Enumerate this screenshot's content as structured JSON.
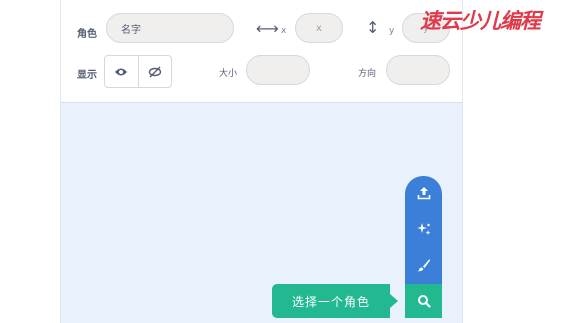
{
  "watermark": {
    "text": "速云少儿编程"
  },
  "sprite_info": {
    "sprite_label": "角色",
    "sprite_name_value": "名字",
    "x_label": "x",
    "x_value": "x",
    "y_label": "y",
    "y_value": "y",
    "show_label": "显示",
    "size_label": "大小",
    "size_value": "",
    "direction_label": "方向",
    "direction_value": ""
  },
  "sprite_menu": {
    "tooltip": "选择一个角色",
    "items": [
      {
        "icon": "upload-icon"
      },
      {
        "icon": "surprise-sparkle-icon"
      },
      {
        "icon": "paint-brush-icon"
      },
      {
        "icon": "search-icon"
      }
    ]
  },
  "colors": {
    "menu_blue": "#3b7fd8",
    "menu_green": "#23b990",
    "stage_bg": "#e9f1fc",
    "watermark_red": "#e0394a"
  }
}
